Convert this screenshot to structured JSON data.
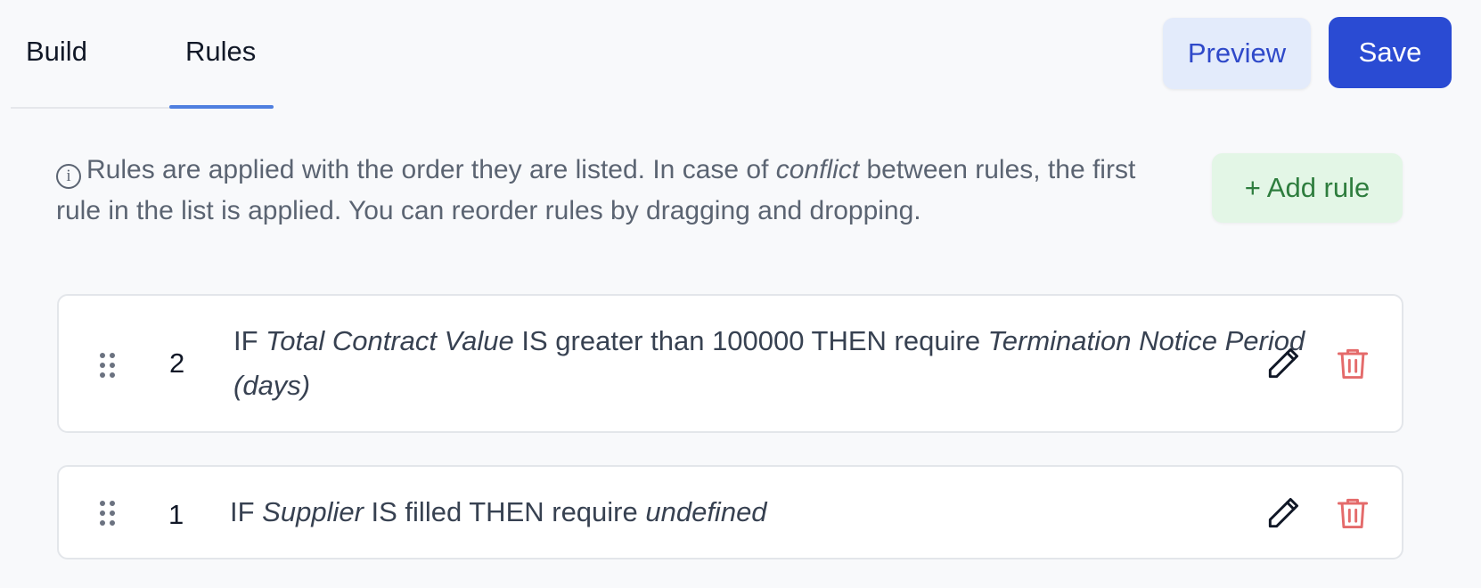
{
  "tabs": [
    {
      "label": "Build",
      "active": false
    },
    {
      "label": "Rules",
      "active": true
    }
  ],
  "header": {
    "preview_label": "Preview",
    "save_label": "Save"
  },
  "info": {
    "text_before": "Rules are applied with the order they are listed. In case of ",
    "emphasis": "conflict",
    "text_after": " between rules, the first rule in the list is applied. You can reorder rules by dragging and dropping."
  },
  "add_rule_label": "+ Add rule",
  "rules": [
    {
      "number": "2",
      "if_kw": "IF ",
      "field": "Total Contract Value",
      "condition": " IS greater than 100000 THEN require ",
      "target": "Termination Notice Period (days)"
    },
    {
      "number": "1",
      "if_kw": "IF ",
      "field": "Supplier",
      "condition": " IS filled THEN require ",
      "target": "undefined"
    }
  ],
  "icons": {
    "info": "info-circle-icon",
    "drag": "drag-handle-icon",
    "edit": "pencil-icon",
    "delete": "trash-icon"
  },
  "colors": {
    "accent": "#2a4bd3",
    "preview_bg": "#e3ebfb",
    "add_bg": "#e3f6e6",
    "add_text": "#2e7d3e",
    "delete": "#e46b6b",
    "tab_underline": "#4f7fe0"
  }
}
